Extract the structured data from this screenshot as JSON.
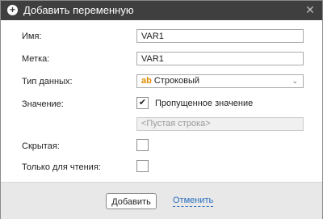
{
  "dialog": {
    "title": "Добавить переменную",
    "title_icon": "plus-circle-icon",
    "close_icon": "close-icon"
  },
  "form": {
    "name_label": "Имя:",
    "name_value": "VAR1",
    "caption_label": "Метка:",
    "caption_value": "VAR1",
    "type_label": "Тип данных:",
    "type_icon_text": "ab",
    "type_value": "Строковый",
    "value_label": "Значение:",
    "missing_checked": true,
    "missing_label": "Пропущенное значение",
    "empty_placeholder": "<Пустая строка>",
    "hidden_label": "Скрытая:",
    "hidden_checked": false,
    "readonly_label": "Только для чтения:",
    "readonly_checked": false
  },
  "footer": {
    "add_label": "Добавить",
    "cancel_label": "Отменить"
  },
  "colors": {
    "titlebar": "#3f3f3f",
    "footer": "#e8e8e8",
    "link": "#2a6ebf",
    "type_icon": "#e08a00"
  }
}
